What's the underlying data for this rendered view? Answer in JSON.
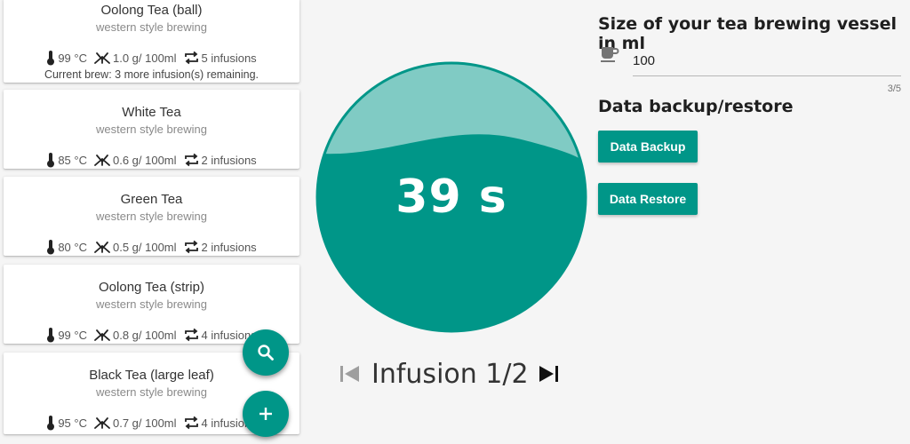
{
  "tea_list": [
    {
      "name": "Oolong Tea (ball)",
      "style": "western style brewing",
      "temperature": "99 °C",
      "amount": "1.0 g/ 100ml",
      "infusions": "5 infusions",
      "note": "Current brew: 3 more infusion(s) remaining."
    },
    {
      "name": "White Tea",
      "style": "western style brewing",
      "temperature": "85 °C",
      "amount": "0.6 g/ 100ml",
      "infusions": "2 infusions"
    },
    {
      "name": "Green Tea",
      "style": "western style brewing",
      "temperature": "80 °C",
      "amount": "0.5 g/ 100ml",
      "infusions": "2 infusions"
    },
    {
      "name": "Oolong Tea (strip)",
      "style": "western style brewing",
      "temperature": "99 °C",
      "amount": "0.8 g/ 100ml",
      "infusions": "4 infusions"
    },
    {
      "name": "Black Tea (large leaf)",
      "style": "western style brewing",
      "temperature": "95 °C",
      "amount": "0.7 g/ 100ml",
      "infusions": "4 infusions"
    }
  ],
  "fabs": {
    "search_icon": "search-icon",
    "add_icon": "add-icon"
  },
  "timer": {
    "value": "39 s",
    "remaining_fraction": 0.28,
    "infusion_label": "Infusion 1/2"
  },
  "settings": {
    "vessel_title": "Size of your tea brewing vessel in ml",
    "vessel_value": "100",
    "vessel_counter": "3/5",
    "backup_title": "Data backup/restore",
    "backup_button": "Data Backup",
    "restore_button": "Data Restore"
  },
  "colors": {
    "accent": "#009688",
    "accent_light": "#80CBC4",
    "background": "#F5F5F5"
  }
}
